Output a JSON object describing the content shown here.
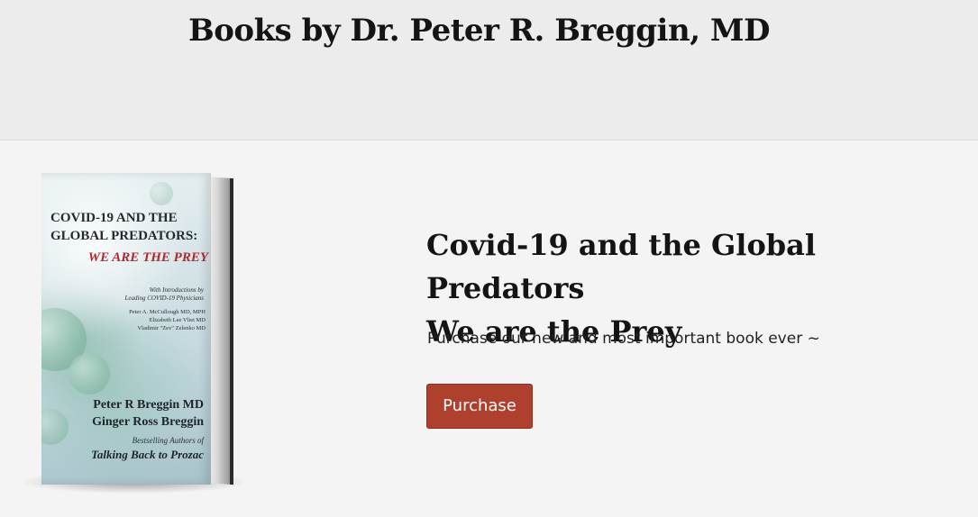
{
  "header": {
    "title": "Books by Dr. Peter R. Breggin, MD"
  },
  "book": {
    "cover": {
      "title_line1": "COVID-19 AND THE",
      "title_line2": "GLOBAL PREDATORS:",
      "subtitle": "WE ARE THE PREY",
      "intro_line1": "With Introductions by",
      "intro_line2": "Leading COVID-19 Physicians",
      "intro_names": [
        "Peter A. McCullough MD, MPH",
        "Elizabeth Lee Vliet MD",
        "Vladimir \"Zev\" Zelenko MD"
      ],
      "author_line1": "Peter R Breggin MD",
      "author_line2": "Ginger Ross Breggin",
      "bestselling": "Bestselling Authors of",
      "previous_book": "Talking Back to Prozac"
    },
    "heading_line1": "Covid-19 and the Global Predators",
    "heading_line2": "We are the Prey",
    "blurb": "Purchase our new and most important book ever ~",
    "purchase_label": "Purchase"
  }
}
